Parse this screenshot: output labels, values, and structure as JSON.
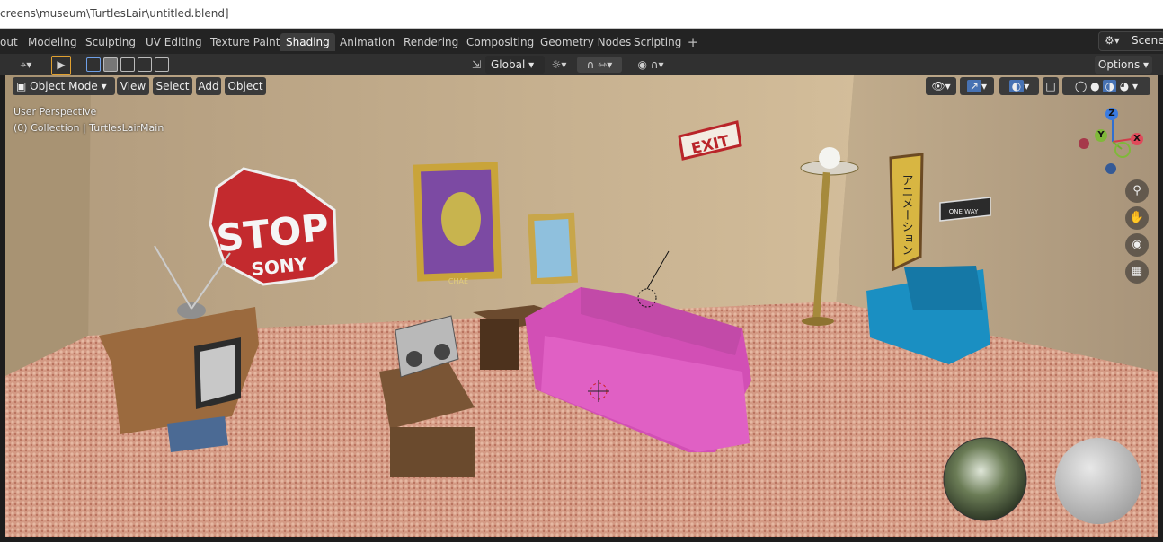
{
  "title_path": "creens\\museum\\TurtlesLair\\untitled.blend]",
  "workspace_tabs": [
    "out",
    "Modeling",
    "Sculpting",
    "UV Editing",
    "Texture Paint",
    "Shading",
    "Animation",
    "Rendering",
    "Compositing",
    "Geometry Nodes",
    "Scripting"
  ],
  "active_tab": "Shading",
  "add_tab_label": "+",
  "scene_label": "Scene",
  "toolbar": {
    "transform_orientation": "Global",
    "options_label": "Options"
  },
  "viewport_header": {
    "mode": "Object Mode",
    "menus": [
      "View",
      "Select",
      "Add",
      "Object"
    ]
  },
  "overlay": {
    "perspective": "User Perspective",
    "collection": "(0) Collection | TurtlesLairMain"
  },
  "gizmo": {
    "x": "X",
    "y": "Y",
    "z": "Z"
  },
  "scene_text": {
    "stop": "STOP",
    "sony": "SONY",
    "exit": "EXIT",
    "banner": "アニメーション",
    "one_way": "ONE WAY",
    "poster": "CHAE"
  },
  "colors": {
    "accent": "#4772b3",
    "tab_active": "#3d3d3d",
    "wall": "#c9b390",
    "carpet": "#d99b86",
    "sofa": "#d24fb5",
    "chair": "#1a8fc2"
  }
}
